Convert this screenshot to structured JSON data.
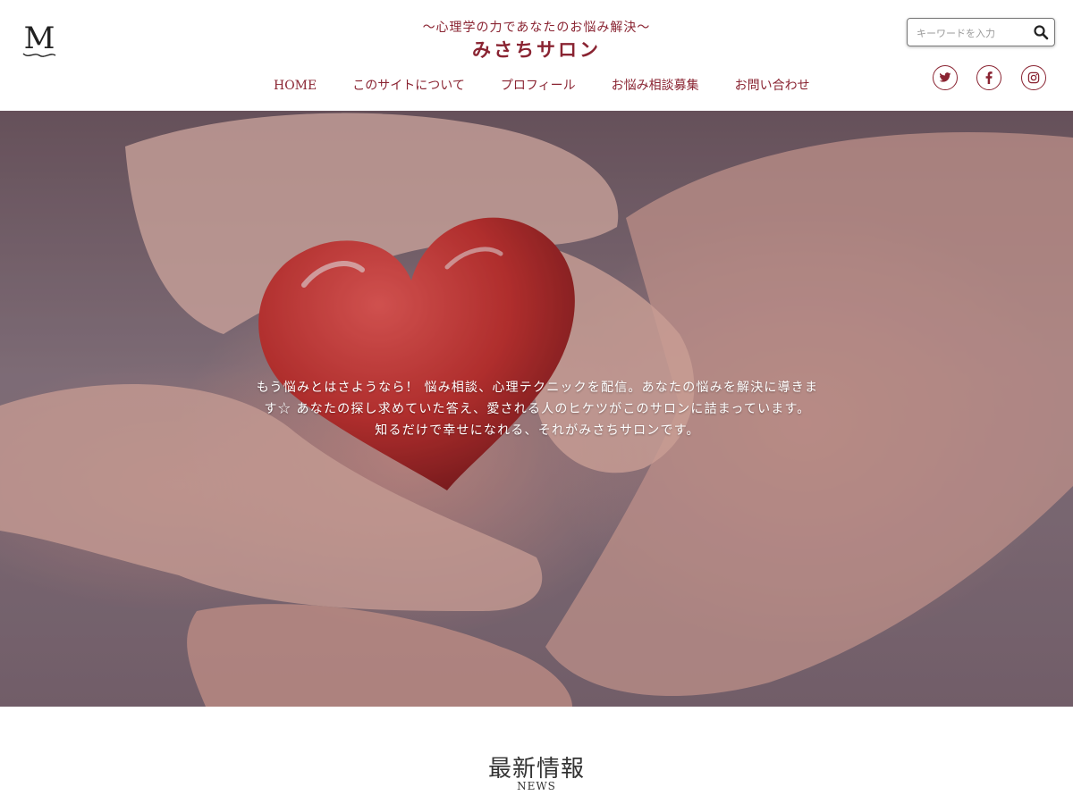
{
  "header": {
    "tagline": "〜心理学の力であなたのお悩み解決〜",
    "title": "みさちサロン",
    "nav": [
      "HOME",
      "このサイトについて",
      "プロフィール",
      "お悩み相談募集",
      "お問い合わせ"
    ],
    "search": {
      "placeholder": "キーワードを入力"
    },
    "social": [
      "twitter-icon",
      "facebook-icon",
      "instagram-icon"
    ],
    "logo_letter": "M"
  },
  "hero": {
    "text": "もう悩みとはさようなら！ 悩み相談、心理テクニックを配信。あなたの悩みを解決に導きます☆ あなたの探し求めていた答え、愛される人のヒケツがこのサロンに詰まっています。 知るだけで幸せになれる、それがみさちサロンです。"
  },
  "news": {
    "title": "最新情報",
    "subtitle": "NEWS"
  },
  "colors": {
    "accent": "#8a2432"
  }
}
